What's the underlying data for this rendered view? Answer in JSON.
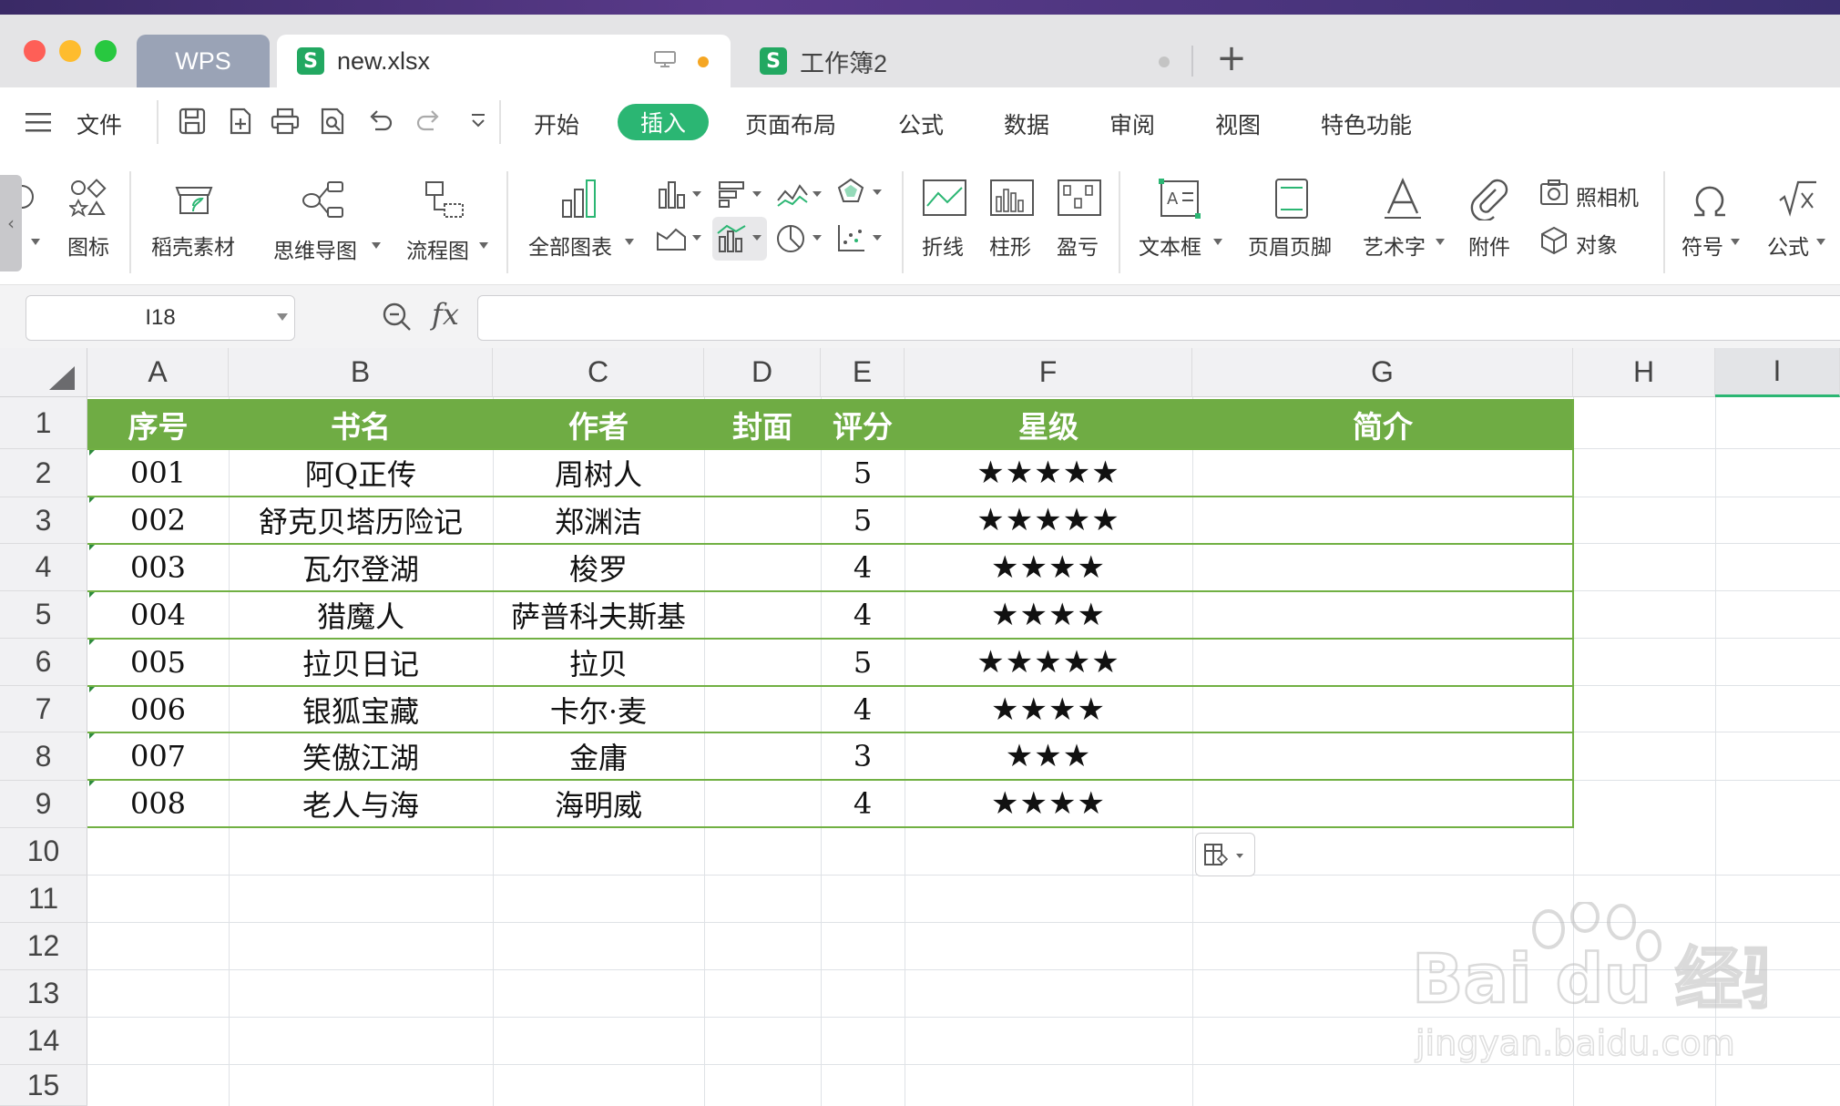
{
  "window": {
    "tabs": [
      {
        "label": "WPS"
      },
      {
        "label": "new.xlsx",
        "icon_letter": "S"
      },
      {
        "label": "工作簿2",
        "icon_letter": "S"
      }
    ],
    "new_tab_label": "+"
  },
  "menu": {
    "file": "文件",
    "items": [
      "开始",
      "插入",
      "页面布局",
      "公式",
      "数据",
      "审阅",
      "视图",
      "特色功能"
    ],
    "active": "插入"
  },
  "ribbon": {
    "icons_label": "图标",
    "stock": "稻壳素材",
    "mindmap": "思维导图",
    "flowchart": "流程图",
    "all_charts": "全部图表",
    "line": "折线",
    "column": "柱形",
    "winloss": "盈亏",
    "textbox": "文本框",
    "header_footer": "页眉页脚",
    "wordart": "艺术字",
    "attachment": "附件",
    "camera": "照相机",
    "object": "对象",
    "symbol": "符号",
    "formula": "公式"
  },
  "formula_bar": {
    "name_box": "I18",
    "fx": "fx",
    "value": ""
  },
  "sheet": {
    "columns": [
      "A",
      "B",
      "C",
      "D",
      "E",
      "F",
      "G",
      "H",
      "I"
    ],
    "rows": [
      "1",
      "2",
      "3",
      "4",
      "5",
      "6",
      "7",
      "8",
      "9",
      "10",
      "11",
      "12",
      "13",
      "14",
      "15"
    ],
    "header": [
      "序号",
      "书名",
      "作者",
      "封面",
      "评分",
      "星级",
      "简介"
    ],
    "data": [
      {
        "id": "001",
        "title": "阿Q正传",
        "author": "周树人",
        "score": "5",
        "stars": "★★★★★"
      },
      {
        "id": "002",
        "title": "舒克贝塔历险记",
        "author": "郑渊洁",
        "score": "5",
        "stars": "★★★★★"
      },
      {
        "id": "003",
        "title": "瓦尔登湖",
        "author": "梭罗",
        "score": "4",
        "stars": "★★★★"
      },
      {
        "id": "004",
        "title": "猎魔人",
        "author": "萨普科夫斯基",
        "score": "4",
        "stars": "★★★★"
      },
      {
        "id": "005",
        "title": "拉贝日记",
        "author": "拉贝",
        "score": "5",
        "stars": "★★★★★"
      },
      {
        "id": "006",
        "title": "银狐宝藏",
        "author": "卡尔·麦",
        "score": "4",
        "stars": "★★★★"
      },
      {
        "id": "007",
        "title": "笑傲江湖",
        "author": "金庸",
        "score": "3",
        "stars": "★★★"
      },
      {
        "id": "008",
        "title": "老人与海",
        "author": "海明威",
        "score": "4",
        "stars": "★★★★"
      }
    ],
    "header_color": "#6fac44",
    "border_color": "#71b043"
  },
  "watermark": {
    "brand": "Bai du 经验",
    "url": "jingyan.baidu.com"
  }
}
